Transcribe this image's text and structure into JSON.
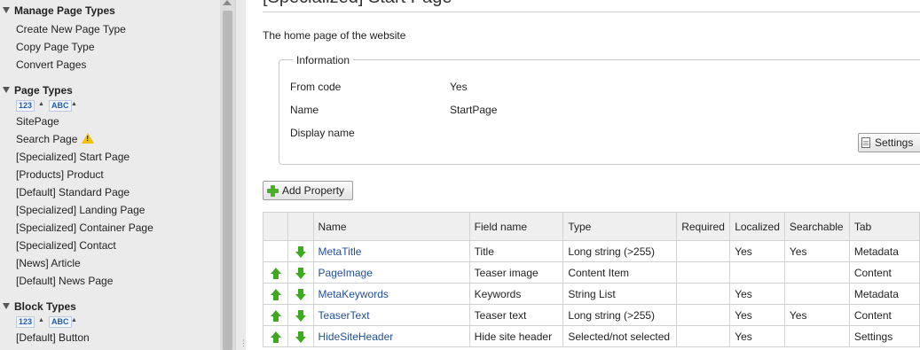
{
  "sidebar": {
    "manage": {
      "heading": "Manage Page Types",
      "links": [
        "Create New Page Type",
        "Copy Page Type",
        "Convert Pages"
      ]
    },
    "page_types": {
      "heading": "Page Types",
      "sort_numeric": "123",
      "sort_alpha": "ABC",
      "items": [
        "SitePage",
        "Search Page",
        "[Specialized] Start Page",
        "[Products] Product",
        "[Default] Standard Page",
        "[Specialized] Landing Page",
        "[Specialized] Container Page",
        "[Specialized] Contact",
        "[News] Article",
        "[Default] News Page"
      ]
    },
    "block_types": {
      "heading": "Block Types",
      "sort_numeric": "123",
      "sort_alpha": "ABC",
      "items": [
        "[Default] Button"
      ]
    }
  },
  "main": {
    "title": "[Specialized] Start Page",
    "description": "The home page of the website",
    "info": {
      "legend": "Information",
      "rows": [
        {
          "label": "From code",
          "value": "Yes"
        },
        {
          "label": "Name",
          "value": "StartPage"
        },
        {
          "label": "Display name",
          "value": ""
        }
      ],
      "settings_button": "Settings"
    },
    "add_property_button": "Add Property",
    "table": {
      "headers": [
        "",
        "",
        "Name",
        "Field name",
        "Type",
        "Required",
        "Localized",
        "Searchable",
        "Tab"
      ],
      "rows": [
        {
          "up": false,
          "down": true,
          "name": "MetaTitle",
          "field": "Title",
          "type": "Long string (>255)",
          "required": "",
          "localized": "Yes",
          "searchable": "Yes",
          "tab": "Metadata"
        },
        {
          "up": true,
          "down": true,
          "name": "PageImage",
          "field": "Teaser image",
          "type": "Content Item",
          "required": "",
          "localized": "",
          "searchable": "",
          "tab": "Content"
        },
        {
          "up": true,
          "down": true,
          "name": "MetaKeywords",
          "field": "Keywords",
          "type": "String List",
          "required": "",
          "localized": "Yes",
          "searchable": "",
          "tab": "Metadata"
        },
        {
          "up": true,
          "down": true,
          "name": "TeaserText",
          "field": "Teaser text",
          "type": "Long string (>255)",
          "required": "",
          "localized": "Yes",
          "searchable": "Yes",
          "tab": "Content"
        },
        {
          "up": true,
          "down": true,
          "name": "HideSiteHeader",
          "field": "Hide site header",
          "type": "Selected/not selected",
          "required": "",
          "localized": "Yes",
          "searchable": "",
          "tab": "Settings"
        }
      ]
    }
  }
}
